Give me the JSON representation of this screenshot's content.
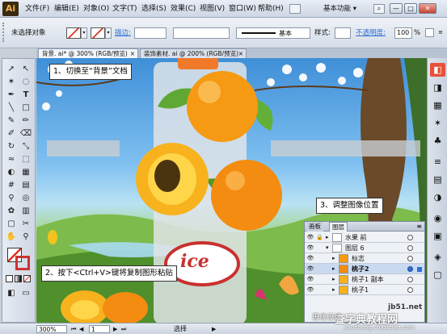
{
  "app": {
    "logo": "Ai",
    "workspace": "基本功能 ▾"
  },
  "menubar": {
    "items": [
      "文件(F)",
      "编辑(E)",
      "对象(O)",
      "文字(T)",
      "选择(S)",
      "效果(C)",
      "视图(V)",
      "窗口(W)",
      "帮助(H)"
    ],
    "window_buttons": [
      "—",
      "□",
      "✕"
    ]
  },
  "control_bar": {
    "selection_label": "未选择对象",
    "stroke_label": "描边:",
    "stroke_style": "基本",
    "style_label": "样式:",
    "opacity_label": "不透明度:",
    "opacity_value": "100",
    "opacity_unit": "%"
  },
  "tabs": [
    {
      "label": "背景. ai* @ 300% (RGB/预览)",
      "close": "×"
    },
    {
      "label": "装饰素材. ai @ 200% (RGB/预览)",
      "close": "×"
    }
  ],
  "callouts": {
    "step1": "1、切换至“背景”文档",
    "step2": "2、按下<Ctrl+V>键将复制图形粘贴",
    "step3": "3、调整图像位置"
  },
  "layers_panel": {
    "tabs": [
      "画板",
      "图层"
    ],
    "rows": [
      {
        "name": "水果 前",
        "selected": false
      },
      {
        "name": "图层 6",
        "selected": false
      },
      {
        "name": "标志",
        "selected": false
      },
      {
        "name": "桃子2",
        "selected": true
      },
      {
        "name": "桃子1 副本",
        "selected": false
      },
      {
        "name": "桃子1",
        "selected": false
      }
    ]
  },
  "canvas_text": {
    "brand": "ice"
  },
  "status_bar": {
    "zoom": "300%",
    "page": "1",
    "tool": "选择"
  },
  "watermark": {
    "site": "jb51.net",
    "label": "查字典教程网",
    "sub": "jiaocheng.chazidian.com",
    "extra": "思缘设计"
  },
  "colors": {
    "accent": "#2f6fd0",
    "peach": "#f59a12",
    "brand_red": "#c8312f"
  },
  "icons": [
    "selection-tool-icon",
    "direct-selection-tool-icon",
    "magic-wand-icon",
    "lasso-icon",
    "pen-tool-icon",
    "type-tool-icon",
    "line-tool-icon",
    "rectangle-tool-icon",
    "brush-icon",
    "pencil-icon",
    "rotate-icon",
    "scale-icon",
    "warp-icon",
    "free-transform-icon",
    "symbol-sprayer-icon",
    "graph-tool-icon",
    "mesh-icon",
    "gradient-icon",
    "eyedropper-icon",
    "blend-icon",
    "slice-icon",
    "eraser-icon",
    "hand-icon",
    "zoom-icon"
  ]
}
